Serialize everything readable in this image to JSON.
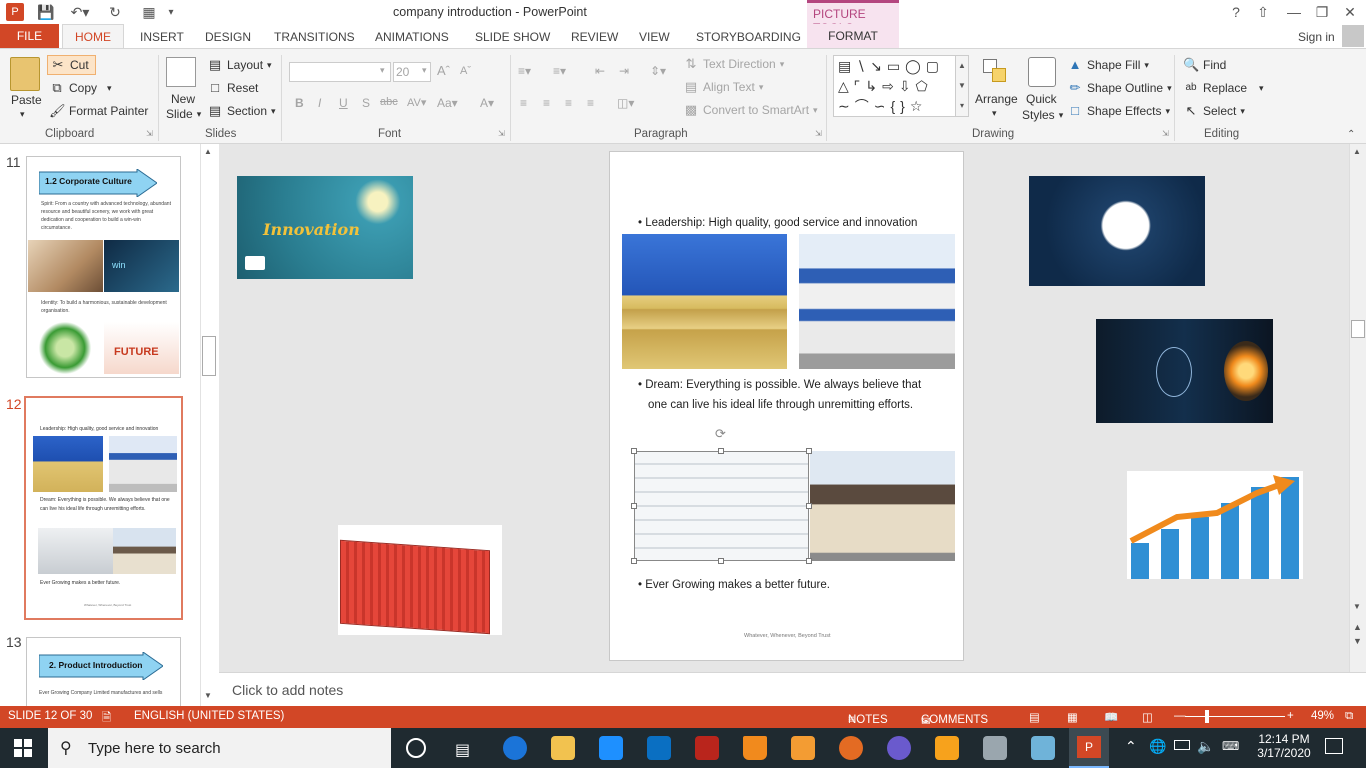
{
  "window": {
    "title": "company introduction - PowerPoint",
    "contextual_tab_group": "PICTURE TOOLS",
    "signin": "Sign in"
  },
  "tabs": [
    "FILE",
    "HOME",
    "INSERT",
    "DESIGN",
    "TRANSITIONS",
    "ANIMATIONS",
    "SLIDE SHOW",
    "REVIEW",
    "VIEW",
    "STORYBOARDING",
    "FORMAT"
  ],
  "clipboard": {
    "paste": "Paste",
    "cut": "Cut",
    "copy": "Copy",
    "format_painter": "Format Painter",
    "label": "Clipboard"
  },
  "slides_group": {
    "new_slide_1": "New",
    "new_slide_2": "Slide",
    "layout": "Layout",
    "reset": "Reset",
    "section": "Section",
    "label": "Slides"
  },
  "font_group": {
    "size": "20",
    "label": "Font"
  },
  "paragraph_group": {
    "text_direction": "Text Direction",
    "align_text": "Align Text",
    "convert_smartart": "Convert to SmartArt",
    "label": "Paragraph"
  },
  "drawing_group": {
    "arrange": "Arrange",
    "quick_styles_1": "Quick",
    "quick_styles_2": "Styles",
    "shape_fill": "Shape Fill",
    "shape_outline": "Shape Outline",
    "shape_effects": "Shape Effects",
    "label": "Drawing"
  },
  "editing_group": {
    "find": "Find",
    "replace": "Replace",
    "select": "Select",
    "label": "Editing"
  },
  "thumbnails": {
    "n11": "11",
    "n12": "12",
    "n13": "13",
    "t11_title": "1.2 Corporate Culture",
    "t11_text1": "Spirit: From a country with advanced technology, abundant resource and beautiful scenery, we work with great dedication and cooperation to build a win-win circumstance.",
    "t11_text2": "Identity: To build a harmonious, sustainable development organisation.",
    "t13_title": "2. Product Introduction",
    "t13_text": "Ever Growing Company Limited manufactures and sells"
  },
  "slide": {
    "bullet1": "Leadership: High quality, good service and innovation",
    "bullet2a": "Dream: Everything is possible. We always believe that",
    "bullet2b": "one can live his ideal life through unremitting efforts.",
    "bullet3": "Ever Growing makes a better future.",
    "footer": "Whatever, Whenever, Beyond Trust"
  },
  "canvas_images": {
    "innovation_word": "Innovation"
  },
  "notes": {
    "placeholder": "Click to add notes"
  },
  "status": {
    "slide": "SLIDE 12 OF 30",
    "language": "ENGLISH (UNITED STATES)",
    "notes": "NOTES",
    "comments": "COMMENTS",
    "zoom": "49%"
  },
  "taskbar": {
    "search_placeholder": "Type here to search",
    "time": "12:14 PM",
    "date": "3/17/2020"
  }
}
